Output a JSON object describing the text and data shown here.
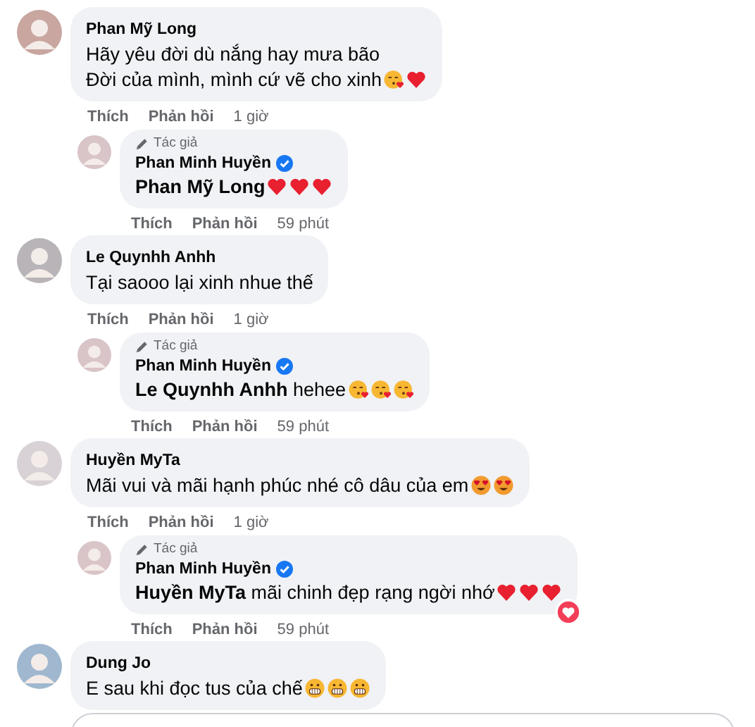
{
  "comments": [
    {
      "author": "Phan Mỹ Long",
      "text": "Hãy yêu đời dù nắng hay mưa bão\nĐời của mình, mình cứ vẽ cho xinh",
      "emojis": [
        {
          "kind": "kiss"
        },
        {
          "kind": "heart"
        }
      ],
      "like": "Thích",
      "reply": "Phản hồi",
      "time": "1 giờ",
      "replies": [
        {
          "badge": "Tác giả",
          "author": "Phan Minh Huyền",
          "verified": true,
          "text": "**Phan Mỹ Long**",
          "emojis": [
            {
              "kind": "heart"
            },
            {
              "kind": "heart"
            },
            {
              "kind": "heart"
            }
          ],
          "like": "Thích",
          "reply": "Phản hồi",
          "time": "59 phút",
          "reacted": false
        }
      ]
    },
    {
      "author": "Le Quynhh Anhh",
      "text": "Tại saooo lại xinh nhue thế",
      "like": "Thích",
      "reply": "Phản hồi",
      "time": "1 giờ",
      "replies": [
        {
          "badge": "Tác giả",
          "author": "Phan Minh Huyền",
          "verified": true,
          "text": "**Le Quynhh Anhh** hehee",
          "emojis": [
            {
              "kind": "kiss"
            },
            {
              "kind": "kiss"
            },
            {
              "kind": "kiss"
            }
          ],
          "like": "Thích",
          "reply": "Phản hồi",
          "time": "59 phút",
          "reacted": false
        }
      ]
    },
    {
      "author": "Huyền MyTa",
      "text": "Mãi vui và mãi hạnh phúc nhé cô dâu của em",
      "emojis": [
        {
          "kind": "hearteyes"
        },
        {
          "kind": "hearteyes"
        }
      ],
      "like": "Thích",
      "reply": "Phản hồi",
      "time": "1 giờ",
      "replies": [
        {
          "badge": "Tác giả",
          "author": "Phan Minh Huyền",
          "verified": true,
          "text": "**Huyền MyTa** mãi chinh đẹp rạng ngời nhớ",
          "emojis": [
            {
              "kind": "heart"
            },
            {
              "kind": "heart"
            },
            {
              "kind": "heart"
            }
          ],
          "like": "Thích",
          "reply": "Phản hồi",
          "time": "59 phút",
          "reacted": true
        }
      ]
    },
    {
      "author": "Dung Jo",
      "text": "E sau khi đọc tus của chế",
      "emojis": [
        {
          "kind": "grimace"
        },
        {
          "kind": "grimace"
        },
        {
          "kind": "grimace"
        }
      ]
    }
  ]
}
